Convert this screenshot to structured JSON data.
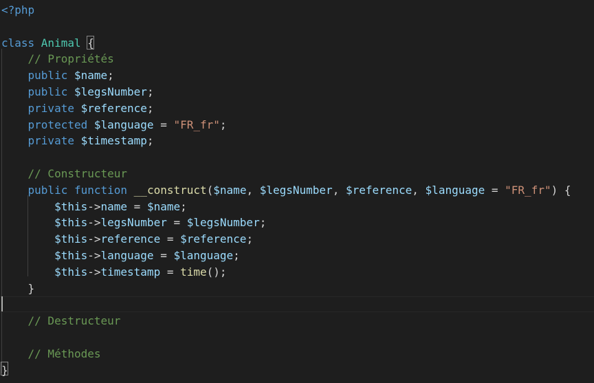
{
  "editor": {
    "language": "php",
    "theme_colors": {
      "background": "#1e1e1e",
      "keyword": "#569cd6",
      "class_name": "#4ec9b0",
      "variable": "#9cdcfe",
      "function": "#dcdcaa",
      "string": "#ce9178",
      "comment": "#6a9955",
      "punctuation": "#d4d4d4"
    },
    "lines": [
      [
        {
          "t": "<?php",
          "c": "tag"
        }
      ],
      [],
      [
        {
          "t": "class ",
          "c": "kw-decl"
        },
        {
          "t": "Animal ",
          "c": "cls"
        },
        {
          "t": "{",
          "c": "punc"
        }
      ],
      [
        {
          "t": "    "
        },
        {
          "t": "// Propriétés",
          "c": "cmt"
        }
      ],
      [
        {
          "t": "    "
        },
        {
          "t": "public ",
          "c": "kw-decl"
        },
        {
          "t": "$name",
          "c": "var"
        },
        {
          "t": ";",
          "c": "punc"
        }
      ],
      [
        {
          "t": "    "
        },
        {
          "t": "public ",
          "c": "kw-decl"
        },
        {
          "t": "$legsNumber",
          "c": "var"
        },
        {
          "t": ";",
          "c": "punc"
        }
      ],
      [
        {
          "t": "    "
        },
        {
          "t": "private ",
          "c": "kw-decl"
        },
        {
          "t": "$reference",
          "c": "var"
        },
        {
          "t": ";",
          "c": "punc"
        }
      ],
      [
        {
          "t": "    "
        },
        {
          "t": "protected ",
          "c": "kw-decl"
        },
        {
          "t": "$language",
          "c": "var"
        },
        {
          "t": " = ",
          "c": "punc"
        },
        {
          "t": "\"FR_fr\"",
          "c": "str"
        },
        {
          "t": ";",
          "c": "punc"
        }
      ],
      [
        {
          "t": "    "
        },
        {
          "t": "private ",
          "c": "kw-decl"
        },
        {
          "t": "$timestamp",
          "c": "var"
        },
        {
          "t": ";",
          "c": "punc"
        }
      ],
      [],
      [
        {
          "t": "    "
        },
        {
          "t": "// Constructeur",
          "c": "cmt"
        }
      ],
      [
        {
          "t": "    "
        },
        {
          "t": "public ",
          "c": "kw-decl"
        },
        {
          "t": "function ",
          "c": "kw-decl"
        },
        {
          "t": "__construct",
          "c": "fn"
        },
        {
          "t": "(",
          "c": "punc"
        },
        {
          "t": "$name",
          "c": "var"
        },
        {
          "t": ", ",
          "c": "punc"
        },
        {
          "t": "$legsNumber",
          "c": "var"
        },
        {
          "t": ", ",
          "c": "punc"
        },
        {
          "t": "$reference",
          "c": "var"
        },
        {
          "t": ", ",
          "c": "punc"
        },
        {
          "t": "$language",
          "c": "var"
        },
        {
          "t": " = ",
          "c": "punc"
        },
        {
          "t": "\"FR_fr\"",
          "c": "str"
        },
        {
          "t": ") {",
          "c": "punc"
        }
      ],
      [
        {
          "t": "        "
        },
        {
          "t": "$this",
          "c": "var"
        },
        {
          "t": "->",
          "c": "punc"
        },
        {
          "t": "name",
          "c": "var"
        },
        {
          "t": " = ",
          "c": "punc"
        },
        {
          "t": "$name",
          "c": "var"
        },
        {
          "t": ";",
          "c": "punc"
        }
      ],
      [
        {
          "t": "        "
        },
        {
          "t": "$this",
          "c": "var"
        },
        {
          "t": "->",
          "c": "punc"
        },
        {
          "t": "legsNumber",
          "c": "var"
        },
        {
          "t": " = ",
          "c": "punc"
        },
        {
          "t": "$legsNumber",
          "c": "var"
        },
        {
          "t": ";",
          "c": "punc"
        }
      ],
      [
        {
          "t": "        "
        },
        {
          "t": "$this",
          "c": "var"
        },
        {
          "t": "->",
          "c": "punc"
        },
        {
          "t": "reference",
          "c": "var"
        },
        {
          "t": " = ",
          "c": "punc"
        },
        {
          "t": "$reference",
          "c": "var"
        },
        {
          "t": ";",
          "c": "punc"
        }
      ],
      [
        {
          "t": "        "
        },
        {
          "t": "$this",
          "c": "var"
        },
        {
          "t": "->",
          "c": "punc"
        },
        {
          "t": "language",
          "c": "var"
        },
        {
          "t": " = ",
          "c": "punc"
        },
        {
          "t": "$language",
          "c": "var"
        },
        {
          "t": ";",
          "c": "punc"
        }
      ],
      [
        {
          "t": "        "
        },
        {
          "t": "$this",
          "c": "var"
        },
        {
          "t": "->",
          "c": "punc"
        },
        {
          "t": "timestamp",
          "c": "var"
        },
        {
          "t": " = ",
          "c": "punc"
        },
        {
          "t": "time",
          "c": "fn"
        },
        {
          "t": "();",
          "c": "punc"
        }
      ],
      [
        {
          "t": "    "
        },
        {
          "t": "}",
          "c": "punc"
        }
      ],
      [],
      [
        {
          "t": "    "
        },
        {
          "t": "// Destructeur",
          "c": "cmt"
        }
      ],
      [],
      [
        {
          "t": "    "
        },
        {
          "t": "// Méthodes",
          "c": "cmt"
        }
      ],
      [
        {
          "t": "}",
          "c": "punc"
        }
      ]
    ]
  }
}
